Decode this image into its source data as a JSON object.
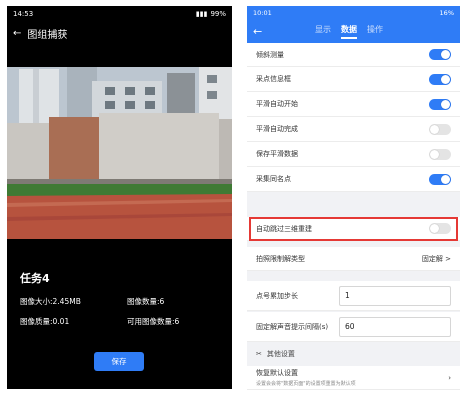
{
  "left": {
    "status": {
      "time": "14:53",
      "battery": "99%"
    },
    "header": {
      "title": "图组捕获"
    },
    "task": {
      "title": "任务4"
    },
    "info": {
      "size_label": "图像大小:2.45MB",
      "count_label": "图像数量:6",
      "quality_label": "图像质量:0.01",
      "usable_label": "可用图像数量:6"
    },
    "save_label": "保存"
  },
  "right": {
    "status": {
      "time": "10:01",
      "battery": "16%"
    },
    "tabs": [
      {
        "label": "显示"
      },
      {
        "label": "数据"
      },
      {
        "label": "操作"
      }
    ],
    "rows": [
      {
        "label": "倾斜测量",
        "state": "on"
      },
      {
        "label": "采点信息框",
        "state": "on"
      },
      {
        "label": "平滑自动开始",
        "state": "on"
      },
      {
        "label": "平滑自动完成",
        "state": "off"
      },
      {
        "label": "保存平滑数据",
        "state": "off"
      },
      {
        "label": "采集同名点",
        "state": "on"
      },
      {
        "label": "自动跳过三维重建",
        "state": "off"
      }
    ],
    "solution_type": {
      "label": "拍照限制解类型",
      "value": "固定解 >"
    },
    "point_step": {
      "label": "点号累加步长",
      "value": "1"
    },
    "alert_interval": {
      "label": "固定解声音提示间隔(s)",
      "value": "60"
    },
    "other_section": {
      "label": "其他设置"
    },
    "restore": {
      "label": "恢复默认设置",
      "desc": "设置会会将\"数据页面\"的设置项重置为默认项"
    }
  }
}
